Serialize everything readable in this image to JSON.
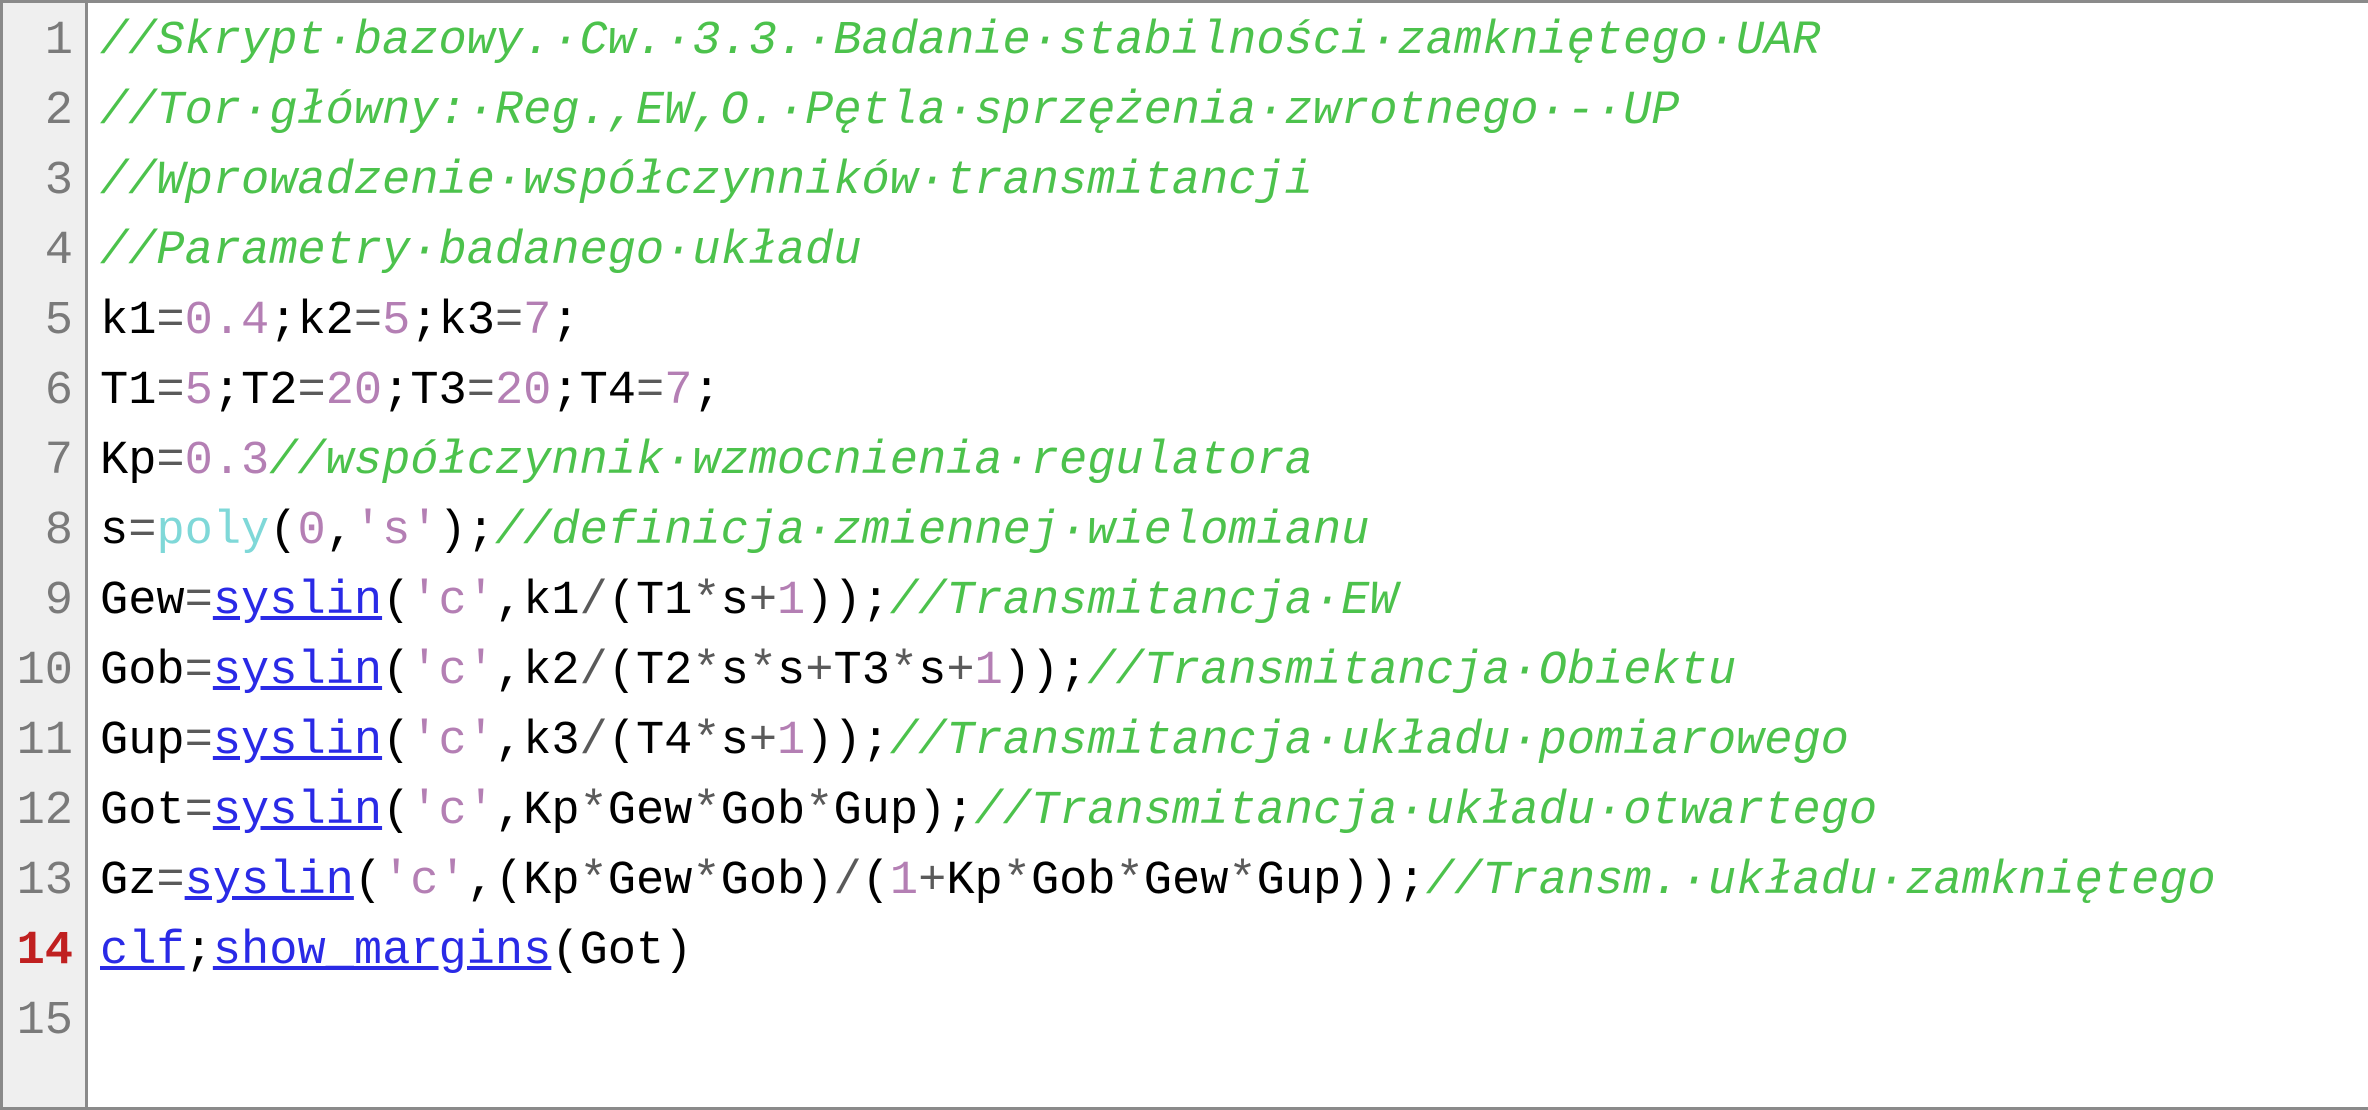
{
  "editor": {
    "current_line_number": 14,
    "lines": [
      {
        "n": 1,
        "tokens": [
          {
            "cls": "tok-comment",
            "t": "//Skrypt·bazowy.·Cw.·3.3.·Badanie·stabilności·zamkniętego·UAR"
          }
        ]
      },
      {
        "n": 2,
        "tokens": [
          {
            "cls": "tok-comment",
            "t": "//Tor·główny:·Reg.,EW,O.·Pętla·sprzężenia·zwrotnego·-·UP"
          }
        ]
      },
      {
        "n": 3,
        "tokens": [
          {
            "cls": "tok-comment",
            "t": "//Wprowadzenie·współczynników·transmitancji"
          }
        ]
      },
      {
        "n": 4,
        "tokens": [
          {
            "cls": "tok-comment",
            "t": "//Parametry·badanego·układu"
          }
        ]
      },
      {
        "n": 5,
        "tokens": [
          {
            "cls": "tok-plain",
            "t": "k1"
          },
          {
            "cls": "tok-op",
            "t": "="
          },
          {
            "cls": "tok-num",
            "t": "0.4"
          },
          {
            "cls": "tok-plain",
            "t": ";k2"
          },
          {
            "cls": "tok-op",
            "t": "="
          },
          {
            "cls": "tok-num",
            "t": "5"
          },
          {
            "cls": "tok-plain",
            "t": ";k3"
          },
          {
            "cls": "tok-op",
            "t": "="
          },
          {
            "cls": "tok-num",
            "t": "7"
          },
          {
            "cls": "tok-plain",
            "t": ";"
          }
        ]
      },
      {
        "n": 6,
        "tokens": [
          {
            "cls": "tok-plain",
            "t": "T1"
          },
          {
            "cls": "tok-op",
            "t": "="
          },
          {
            "cls": "tok-num",
            "t": "5"
          },
          {
            "cls": "tok-plain",
            "t": ";T2"
          },
          {
            "cls": "tok-op",
            "t": "="
          },
          {
            "cls": "tok-num",
            "t": "20"
          },
          {
            "cls": "tok-plain",
            "t": ";T3"
          },
          {
            "cls": "tok-op",
            "t": "="
          },
          {
            "cls": "tok-num",
            "t": "20"
          },
          {
            "cls": "tok-plain",
            "t": ";T4"
          },
          {
            "cls": "tok-op",
            "t": "="
          },
          {
            "cls": "tok-num",
            "t": "7"
          },
          {
            "cls": "tok-plain",
            "t": ";"
          }
        ]
      },
      {
        "n": 7,
        "tokens": [
          {
            "cls": "tok-plain",
            "t": "Kp"
          },
          {
            "cls": "tok-op",
            "t": "="
          },
          {
            "cls": "tok-num",
            "t": "0.3"
          },
          {
            "cls": "tok-comment",
            "t": "//współczynnik·wzmocnienia·regulatora"
          }
        ]
      },
      {
        "n": 8,
        "tokens": [
          {
            "cls": "tok-plain",
            "t": "s"
          },
          {
            "cls": "tok-op",
            "t": "="
          },
          {
            "cls": "tok-fn-builtin",
            "t": "poly"
          },
          {
            "cls": "tok-plain",
            "t": "("
          },
          {
            "cls": "tok-num",
            "t": "0"
          },
          {
            "cls": "tok-plain",
            "t": ","
          },
          {
            "cls": "tok-str",
            "t": "'s'"
          },
          {
            "cls": "tok-plain",
            "t": ");"
          },
          {
            "cls": "tok-comment",
            "t": "//definicja·zmiennej·wielomianu"
          }
        ]
      },
      {
        "n": 9,
        "tokens": [
          {
            "cls": "tok-plain",
            "t": "Gew"
          },
          {
            "cls": "tok-op",
            "t": "="
          },
          {
            "cls": "tok-fn-call",
            "t": "syslin"
          },
          {
            "cls": "tok-plain",
            "t": "("
          },
          {
            "cls": "tok-str",
            "t": "'c'"
          },
          {
            "cls": "tok-plain",
            "t": ",k1"
          },
          {
            "cls": "tok-op",
            "t": "/"
          },
          {
            "cls": "tok-plain",
            "t": "(T1"
          },
          {
            "cls": "tok-op",
            "t": "*"
          },
          {
            "cls": "tok-plain",
            "t": "s"
          },
          {
            "cls": "tok-op",
            "t": "+"
          },
          {
            "cls": "tok-num",
            "t": "1"
          },
          {
            "cls": "tok-plain",
            "t": "));"
          },
          {
            "cls": "tok-comment",
            "t": "//Transmitancja·EW"
          }
        ]
      },
      {
        "n": 10,
        "tokens": [
          {
            "cls": "tok-plain",
            "t": "Gob"
          },
          {
            "cls": "tok-op",
            "t": "="
          },
          {
            "cls": "tok-fn-call",
            "t": "syslin"
          },
          {
            "cls": "tok-plain",
            "t": "("
          },
          {
            "cls": "tok-str",
            "t": "'c'"
          },
          {
            "cls": "tok-plain",
            "t": ",k2"
          },
          {
            "cls": "tok-op",
            "t": "/"
          },
          {
            "cls": "tok-plain",
            "t": "(T2"
          },
          {
            "cls": "tok-op",
            "t": "*"
          },
          {
            "cls": "tok-plain",
            "t": "s"
          },
          {
            "cls": "tok-op",
            "t": "*"
          },
          {
            "cls": "tok-plain",
            "t": "s"
          },
          {
            "cls": "tok-op",
            "t": "+"
          },
          {
            "cls": "tok-plain",
            "t": "T3"
          },
          {
            "cls": "tok-op",
            "t": "*"
          },
          {
            "cls": "tok-plain",
            "t": "s"
          },
          {
            "cls": "tok-op",
            "t": "+"
          },
          {
            "cls": "tok-num",
            "t": "1"
          },
          {
            "cls": "tok-plain",
            "t": "));"
          },
          {
            "cls": "tok-comment",
            "t": "//Transmitancja·Obiektu"
          }
        ]
      },
      {
        "n": 11,
        "tokens": [
          {
            "cls": "tok-plain",
            "t": "Gup"
          },
          {
            "cls": "tok-op",
            "t": "="
          },
          {
            "cls": "tok-fn-call",
            "t": "syslin"
          },
          {
            "cls": "tok-plain",
            "t": "("
          },
          {
            "cls": "tok-str",
            "t": "'c'"
          },
          {
            "cls": "tok-plain",
            "t": ",k3"
          },
          {
            "cls": "tok-op",
            "t": "/"
          },
          {
            "cls": "tok-plain",
            "t": "(T4"
          },
          {
            "cls": "tok-op",
            "t": "*"
          },
          {
            "cls": "tok-plain",
            "t": "s"
          },
          {
            "cls": "tok-op",
            "t": "+"
          },
          {
            "cls": "tok-num",
            "t": "1"
          },
          {
            "cls": "tok-plain",
            "t": "));"
          },
          {
            "cls": "tok-comment",
            "t": "//Transmitancja·układu·pomiarowego"
          }
        ]
      },
      {
        "n": 12,
        "tokens": [
          {
            "cls": "tok-plain",
            "t": "Got"
          },
          {
            "cls": "tok-op",
            "t": "="
          },
          {
            "cls": "tok-fn-call",
            "t": "syslin"
          },
          {
            "cls": "tok-plain",
            "t": "("
          },
          {
            "cls": "tok-str",
            "t": "'c'"
          },
          {
            "cls": "tok-plain",
            "t": ",Kp"
          },
          {
            "cls": "tok-op",
            "t": "*"
          },
          {
            "cls": "tok-plain",
            "t": "Gew"
          },
          {
            "cls": "tok-op",
            "t": "*"
          },
          {
            "cls": "tok-plain",
            "t": "Gob"
          },
          {
            "cls": "tok-op",
            "t": "*"
          },
          {
            "cls": "tok-plain",
            "t": "Gup);"
          },
          {
            "cls": "tok-comment",
            "t": "//Transmitancja·układu·otwartego"
          }
        ]
      },
      {
        "n": 13,
        "tokens": [
          {
            "cls": "tok-plain",
            "t": "Gz"
          },
          {
            "cls": "tok-op",
            "t": "="
          },
          {
            "cls": "tok-fn-call",
            "t": "syslin"
          },
          {
            "cls": "tok-plain",
            "t": "("
          },
          {
            "cls": "tok-str",
            "t": "'c'"
          },
          {
            "cls": "tok-plain",
            "t": ",(Kp"
          },
          {
            "cls": "tok-op",
            "t": "*"
          },
          {
            "cls": "tok-plain",
            "t": "Gew"
          },
          {
            "cls": "tok-op",
            "t": "*"
          },
          {
            "cls": "tok-plain",
            "t": "Gob)"
          },
          {
            "cls": "tok-op",
            "t": "/"
          },
          {
            "cls": "tok-plain",
            "t": "("
          },
          {
            "cls": "tok-num",
            "t": "1"
          },
          {
            "cls": "tok-op",
            "t": "+"
          },
          {
            "cls": "tok-plain",
            "t": "Kp"
          },
          {
            "cls": "tok-op",
            "t": "*"
          },
          {
            "cls": "tok-plain",
            "t": "Gob"
          },
          {
            "cls": "tok-op",
            "t": "*"
          },
          {
            "cls": "tok-plain",
            "t": "Gew"
          },
          {
            "cls": "tok-op",
            "t": "*"
          },
          {
            "cls": "tok-plain",
            "t": "Gup));"
          },
          {
            "cls": "tok-comment",
            "t": "//Transm.·układu·zamkniętego"
          }
        ]
      },
      {
        "n": 14,
        "tokens": [
          {
            "cls": "tok-fn-call",
            "t": "clf"
          },
          {
            "cls": "tok-plain",
            "t": ";"
          },
          {
            "cls": "tok-fn-call",
            "t": "show_margins"
          },
          {
            "cls": "tok-plain",
            "t": "(Got)"
          }
        ]
      },
      {
        "n": 15,
        "tokens": []
      }
    ]
  }
}
